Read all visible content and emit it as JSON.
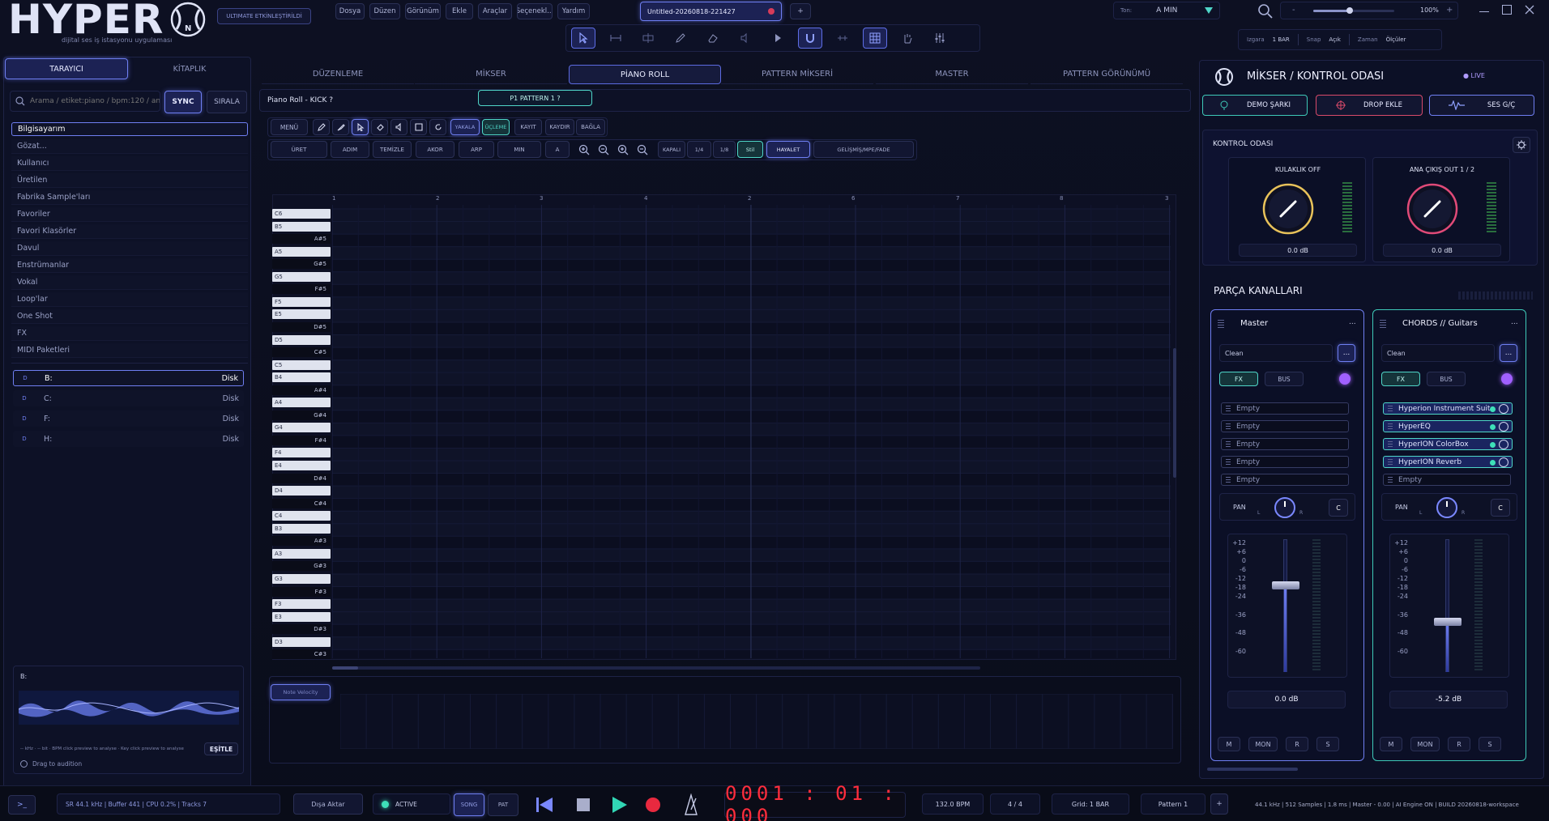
{
  "app": {
    "logo": "HYPER",
    "logo_badge": "N",
    "subtitle": "dijital ses iş istasyonu uygulaması",
    "edition": "ULTIMATE ETKİNLEŞTİRİLDİ"
  },
  "menu": [
    "Dosya",
    "Düzen",
    "Görünüm",
    "Ekle",
    "Araçlar",
    "Seçenekl...",
    "Yardım"
  ],
  "project_tab": {
    "title": "Untitled-20260818-221427",
    "add": "+"
  },
  "key_select": {
    "label": "Ton:",
    "value": "A MIN"
  },
  "zoom": {
    "minus": "-",
    "value": "100%",
    "plus": "+",
    "level": 0.45
  },
  "snap_bar": {
    "grid_label": "Izgara",
    "grid_value": "1 BAR",
    "snap_label": "Snap",
    "snap_value": "Açık",
    "time_label": "Zaman",
    "time_value": "Ölçüler"
  },
  "browser": {
    "tabs": [
      "TARAYICI",
      "KİTAPLIK"
    ],
    "search_placeholder": "Arama / etiket:piano / bpm:120 / an...",
    "sync": "SYNC",
    "sort": "SIRALA",
    "locations": [
      "Bilgisayarım",
      "Gözat...",
      "Kullanıcı",
      "Üretilen",
      "Fabrika Sample'ları",
      "Favoriler",
      "Favori Klasörler",
      "Davul",
      "Enstrümanlar",
      "Vokal",
      "Loop'lar",
      "One Shot",
      "FX",
      "MIDI Paketleri"
    ],
    "drives": [
      {
        "icon": "D",
        "name": "B:",
        "type": "Disk"
      },
      {
        "icon": "D",
        "name": "C:",
        "type": "Disk"
      },
      {
        "icon": "D",
        "name": "F:",
        "type": "Disk"
      },
      {
        "icon": "D",
        "name": "H:",
        "type": "Disk"
      }
    ],
    "preview": {
      "title": "B:",
      "info": "-- kHz · -- bit · BPM click preview to analyse · Key click preview to analyse",
      "match": "EŞİTLE",
      "audition": "Drag to audition"
    }
  },
  "view_tabs": [
    "DÜZENLEME",
    "MİKSER",
    "PİANO ROLL",
    "PATTERN MİKSERİ",
    "MASTER",
    "PATTERN GÖRÜNÜMÜ"
  ],
  "piano_roll": {
    "title": "Piano Roll - KICK ?",
    "pattern": "P1  PATTERN 1  ?",
    "toolbar1": [
      "MENÜ",
      "KAYIT",
      "KAYDIR",
      "BAĞLA"
    ],
    "toolbar1_toggle": [
      "YAKALA",
      "ÜÇLEME"
    ],
    "toolbar2": [
      "ÜRET",
      "ADIM",
      "TEMİZLE",
      "AKOR",
      "ARP",
      "MIN",
      "A",
      "KAPALI",
      "1/4",
      "1/8",
      "Stil",
      "HAYALET",
      "GELİŞMİŞ/MPE/FADE"
    ],
    "bars": [
      "1",
      "2",
      "3",
      "4",
      "2",
      "6",
      "7",
      "8",
      "3"
    ],
    "keys": [
      {
        "n": "C6",
        "t": "w"
      },
      {
        "n": "B5",
        "t": "w"
      },
      {
        "n": "A#5",
        "t": "b"
      },
      {
        "n": "A5",
        "t": "w"
      },
      {
        "n": "G#5",
        "t": "b"
      },
      {
        "n": "G5",
        "t": "w"
      },
      {
        "n": "F#5",
        "t": "b"
      },
      {
        "n": "F5",
        "t": "w"
      },
      {
        "n": "E5",
        "t": "w"
      },
      {
        "n": "D#5",
        "t": "b"
      },
      {
        "n": "D5",
        "t": "w"
      },
      {
        "n": "C#5",
        "t": "b"
      },
      {
        "n": "C5",
        "t": "w"
      },
      {
        "n": "B4",
        "t": "w"
      },
      {
        "n": "A#4",
        "t": "b"
      },
      {
        "n": "A4",
        "t": "w"
      },
      {
        "n": "G#4",
        "t": "b"
      },
      {
        "n": "G4",
        "t": "w"
      },
      {
        "n": "F#4",
        "t": "b"
      },
      {
        "n": "F4",
        "t": "w"
      },
      {
        "n": "E4",
        "t": "w"
      },
      {
        "n": "D#4",
        "t": "b"
      },
      {
        "n": "D4",
        "t": "w"
      },
      {
        "n": "C#4",
        "t": "b"
      },
      {
        "n": "C4",
        "t": "w"
      },
      {
        "n": "B3",
        "t": "w"
      },
      {
        "n": "A#3",
        "t": "b"
      },
      {
        "n": "A3",
        "t": "w"
      },
      {
        "n": "G#3",
        "t": "b"
      },
      {
        "n": "G3",
        "t": "w"
      },
      {
        "n": "F#3",
        "t": "b"
      },
      {
        "n": "F3",
        "t": "w"
      },
      {
        "n": "E3",
        "t": "w"
      },
      {
        "n": "D#3",
        "t": "b"
      },
      {
        "n": "D3",
        "t": "w"
      },
      {
        "n": "C#3",
        "t": "b"
      }
    ],
    "velocity_label": "Note Velocity"
  },
  "mixer": {
    "title": "MİKSER / KONTROL ODASI",
    "live": "LIVE",
    "demo": "DEMO ŞARKI",
    "drop": "DROP EKLE",
    "io": "SES G/Ç",
    "control_room": "KONTROL ODASI",
    "knobs": [
      {
        "label": "KULAKLIK OFF",
        "value": "0.0 dB",
        "color": "#e8c25a"
      },
      {
        "label": "ANA ÇIKIŞ OUT 1 / 2",
        "value": "0.0 dB",
        "color": "#e04a78"
      }
    ],
    "tracks_title": "PARÇA KANALLARI",
    "channels": [
      {
        "name": "Master",
        "more": "...",
        "preset": "Clean",
        "fx": "FX",
        "bus": "BUS",
        "plugins": [
          "Empty",
          "Empty",
          "Empty",
          "Empty",
          "Empty"
        ],
        "filled": 0,
        "pan": "PAN",
        "pan_l": "L",
        "pan_r": "R",
        "pan_c": "C",
        "fader": 0.65,
        "db": "0.0 dB",
        "buttons": [
          "M",
          "MON",
          "R",
          "S"
        ]
      },
      {
        "name": "CHORDS // Guitars",
        "more": "...",
        "preset": "Clean",
        "fx": "FX",
        "bus": "BUS",
        "plugins": [
          "Hyperion Instrument Suite",
          "HyperEQ",
          "HyperION ColorBox",
          "HyperION Reverb",
          "Empty"
        ],
        "filled": 4,
        "pan": "PAN",
        "pan_l": "L",
        "pan_r": "R",
        "pan_c": "C",
        "fader": 0.38,
        "db": "-5.2 dB",
        "buttons": [
          "M",
          "MON",
          "R",
          "S"
        ]
      }
    ],
    "scale": [
      "+12",
      "+6",
      "0",
      "-6",
      "-12",
      "-18",
      "-24",
      "-36",
      "-48",
      "-60"
    ]
  },
  "transport": {
    "terminal": ">_",
    "info": "SR 44.1 kHz  |  Buffer 441  |  CPU 0.2%  |  Tracks 7",
    "export": "Dışa Aktar",
    "engine": "ACTIVE",
    "song": "SONG",
    "pat": "PAT",
    "time": "0001 : 01 : 000",
    "bpm": "132.0 BPM",
    "meter": "4 / 4",
    "grid": "Grid: 1 BAR",
    "pattern": "Pattern 1",
    "add": "+",
    "status": "44.1 kHz  |  512 Samples  |  1.8 ms  |  Master - 0.00  |  AI Engine ON  |  BUILD 20260818-workspace"
  }
}
